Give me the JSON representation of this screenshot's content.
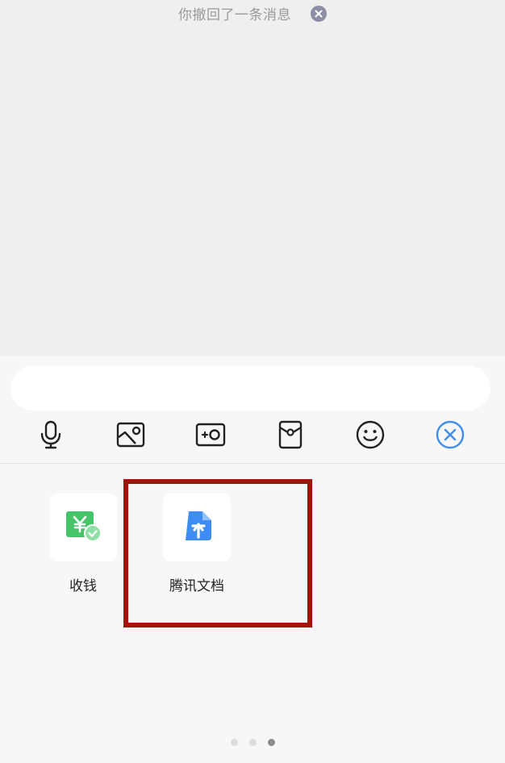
{
  "chat": {
    "system_message": "你撤回了一条消息"
  },
  "toolbar": {
    "icons": [
      "microphone-icon",
      "image-icon",
      "camera-icon",
      "red-packet-icon",
      "emoji-icon",
      "close-panel-icon"
    ],
    "accent_color": "#3d8ef0"
  },
  "apps": [
    {
      "label": "收钱",
      "icon": "receive-money-icon",
      "color": "#45c46a"
    },
    {
      "label": "腾讯文档",
      "icon": "tencent-docs-icon",
      "color": "#3d8ef0"
    }
  ],
  "highlight_color": "#a4130b",
  "pagination": {
    "pages": 3,
    "current": 3
  }
}
